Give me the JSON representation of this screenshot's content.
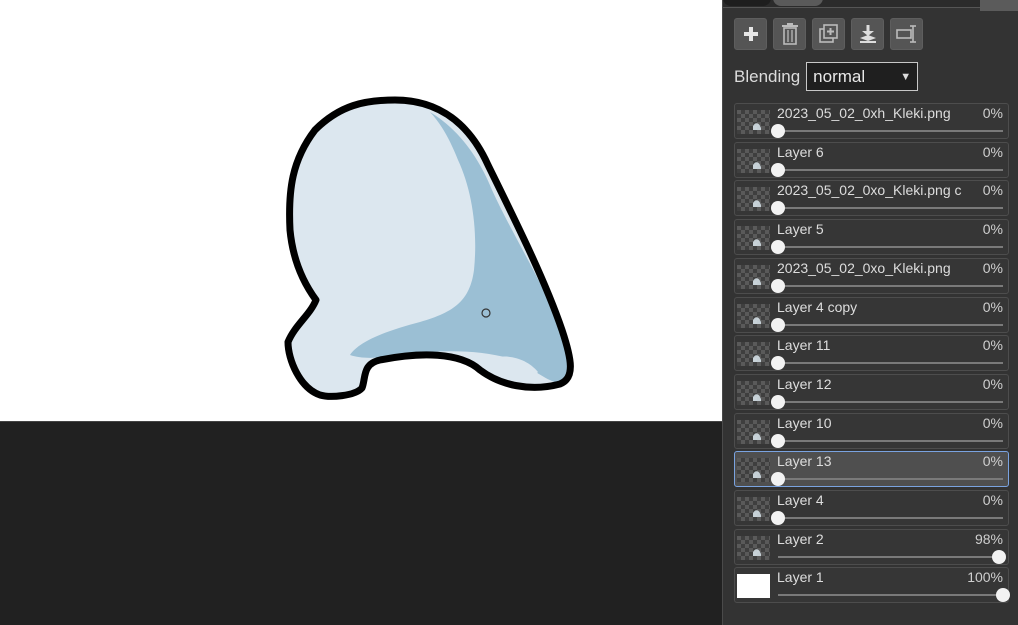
{
  "panel": {
    "toolbar": [
      {
        "name": "add-layer-button",
        "icon": "plus-icon"
      },
      {
        "name": "delete-layer-button",
        "icon": "trash-icon"
      },
      {
        "name": "duplicate-layer-button",
        "icon": "duplicate-icon"
      },
      {
        "name": "merge-down-button",
        "icon": "merge-down-icon"
      },
      {
        "name": "rename-layer-button",
        "icon": "rename-icon"
      }
    ],
    "blending_label": "Blending",
    "blending_value": "normal",
    "layers": [
      {
        "name": "2023_05_02_0xh_Kleki.png",
        "opacity": "0%",
        "level": 0,
        "thumb": "checker"
      },
      {
        "name": "Layer 6",
        "opacity": "0%",
        "level": 0,
        "thumb": "checker"
      },
      {
        "name": "2023_05_02_0xo_Kleki.png c",
        "opacity": "0%",
        "level": 0,
        "thumb": "checker"
      },
      {
        "name": "Layer 5",
        "opacity": "0%",
        "level": 0,
        "thumb": "checker"
      },
      {
        "name": "2023_05_02_0xo_Kleki.png",
        "opacity": "0%",
        "level": 0,
        "thumb": "checker"
      },
      {
        "name": "Layer 4 copy",
        "opacity": "0%",
        "level": 0,
        "thumb": "checker"
      },
      {
        "name": "Layer 11",
        "opacity": "0%",
        "level": 0,
        "thumb": "checker"
      },
      {
        "name": "Layer 12",
        "opacity": "0%",
        "level": 0,
        "thumb": "checker"
      },
      {
        "name": "Layer 10",
        "opacity": "0%",
        "level": 0,
        "thumb": "checker"
      },
      {
        "name": "Layer 13",
        "opacity": "0%",
        "level": 0,
        "thumb": "checker",
        "selected": true
      },
      {
        "name": "Layer 4",
        "opacity": "0%",
        "level": 0,
        "thumb": "checker"
      },
      {
        "name": "Layer 2",
        "opacity": "98%",
        "level": 0.98,
        "thumb": "checker"
      },
      {
        "name": "Layer 1",
        "opacity": "100%",
        "level": 1.0,
        "thumb": "white"
      }
    ]
  },
  "colors": {
    "canvas_bg": "#ffffff",
    "workspace_bg": "#212121",
    "panel_bg": "#333333",
    "shape_light": "#dce7ef",
    "shape_shadow": "#9bbfd4",
    "outline": "#000000",
    "selection_border": "#7aa3e0"
  }
}
